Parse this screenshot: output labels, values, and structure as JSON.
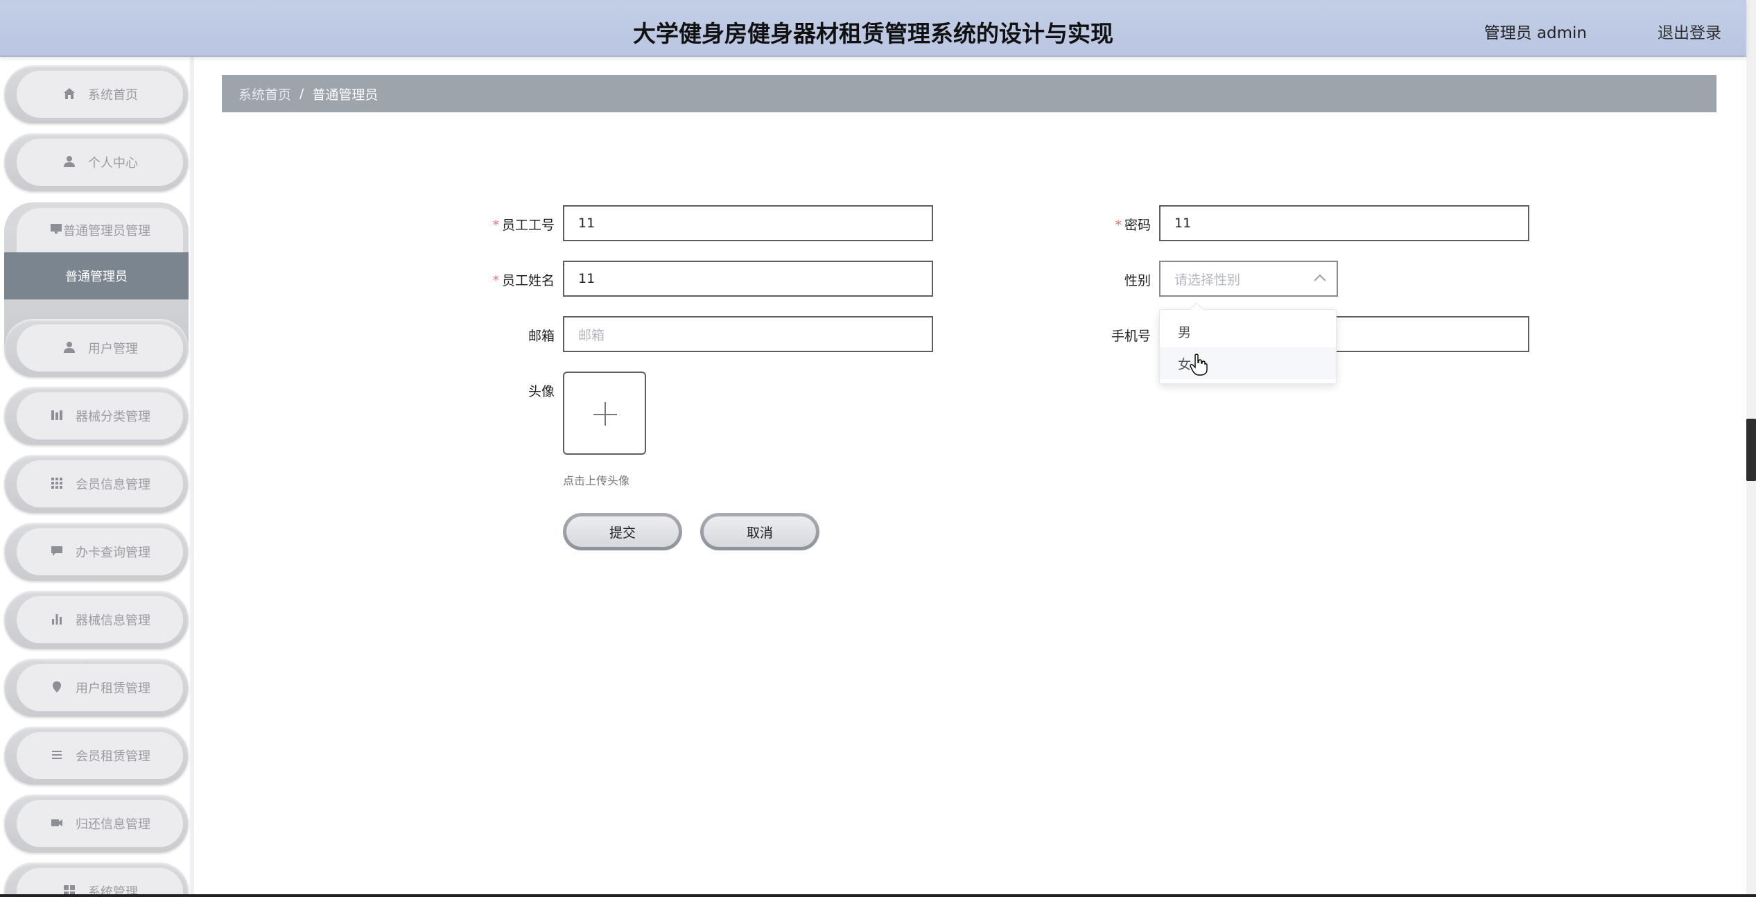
{
  "header": {
    "title": "大学健身房健身器材租赁管理系统的设计与实现",
    "user": "管理员 admin",
    "logout": "退出登录"
  },
  "sidebar": {
    "items": [
      {
        "label": "系统首页",
        "icon": "home-icon"
      },
      {
        "label": "个人中心",
        "icon": "user-icon"
      },
      {
        "label": "普通管理员管理",
        "icon": "monitor-icon",
        "sub": "普通管理员"
      },
      {
        "label": "用户管理",
        "icon": "user-icon"
      },
      {
        "label": "器械分类管理",
        "icon": "bars-icon"
      },
      {
        "label": "会员信息管理",
        "icon": "grid-icon"
      },
      {
        "label": "办卡查询管理",
        "icon": "chat-icon"
      },
      {
        "label": "器械信息管理",
        "icon": "chart-icon"
      },
      {
        "label": "用户租赁管理",
        "icon": "location-icon"
      },
      {
        "label": "会员租赁管理",
        "icon": "list-icon"
      },
      {
        "label": "归还信息管理",
        "icon": "video-icon"
      },
      {
        "label": "系统管理",
        "icon": "grid-icon"
      }
    ]
  },
  "breadcrumb": {
    "home": "系统首页",
    "separator": "/",
    "current": "普通管理员"
  },
  "form": {
    "employee_no": {
      "label": "员工工号",
      "value": "11",
      "required": true
    },
    "password": {
      "label": "密码",
      "value": "11",
      "required": true
    },
    "employee_name": {
      "label": "员工姓名",
      "value": "11",
      "required": true
    },
    "gender": {
      "label": "性别",
      "placeholder": "请选择性别",
      "options": [
        "男",
        "女"
      ]
    },
    "email": {
      "label": "邮箱",
      "placeholder": "邮箱"
    },
    "phone": {
      "label": "手机号"
    },
    "avatar": {
      "label": "头像",
      "tip": "点击上传头像"
    },
    "submit": "提交",
    "cancel": "取消",
    "required_mark": "*"
  }
}
